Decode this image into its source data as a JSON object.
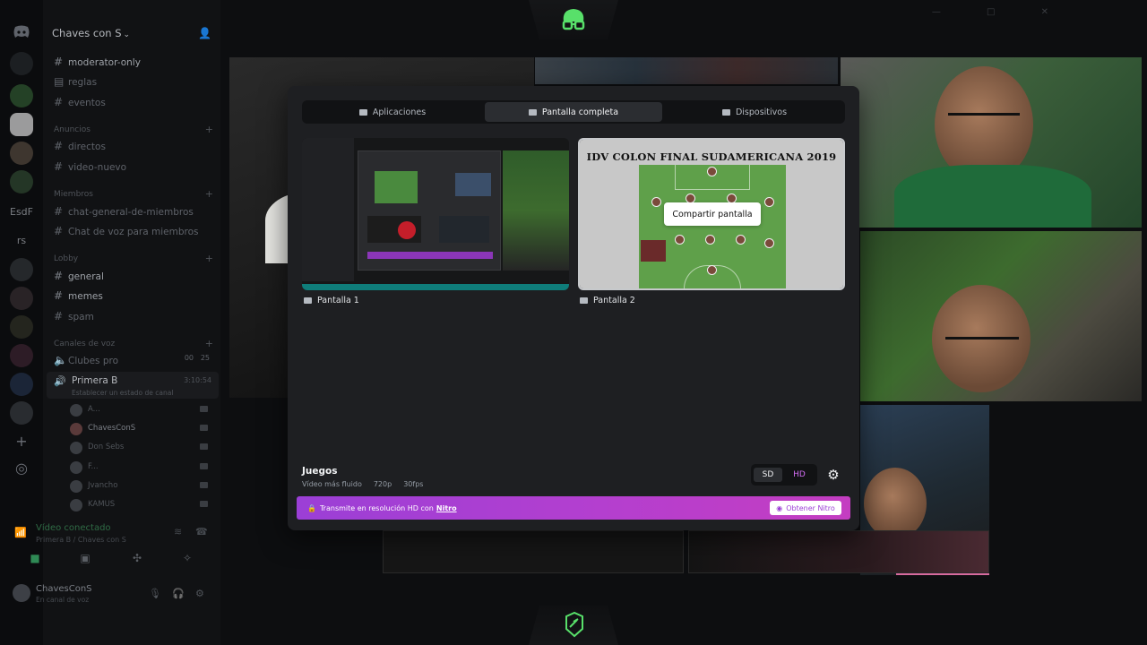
{
  "server": {
    "name": "Chaves con S",
    "rail_labels": [
      "EsdF",
      "rs"
    ]
  },
  "channels": {
    "top": [
      {
        "name": "moderator-only",
        "bright": true
      },
      {
        "name": "reglas",
        "bright": false
      },
      {
        "name": "eventos",
        "bright": false
      }
    ],
    "categories": {
      "anuncios": "Anuncios",
      "miembros": "Miembros",
      "lobby": "Lobby",
      "voz": "Canales de voz"
    },
    "anuncios": [
      "directos",
      "video-nuevo"
    ],
    "miembros": [
      "chat-general-de-miembros",
      "Chat de voz para miembros"
    ],
    "lobby": [
      {
        "name": "general",
        "bright": true
      },
      {
        "name": "memes",
        "bright": true
      },
      {
        "name": "spam",
        "bright": false
      }
    ],
    "voice": {
      "clubes": "Clubes pro",
      "clubes_count": "00",
      "clubes_count2": "25",
      "active_name": "Primera B",
      "active_sub": "Establecer un estado de canal",
      "active_time": "3:10:54",
      "members": [
        "A...",
        "ChavesConS",
        "Don Sebs",
        "F...",
        "Jvancho",
        "KAMUS"
      ]
    }
  },
  "voice_status": {
    "title": "Vídeo conectado",
    "sub": "Primera B / Chaves con S"
  },
  "user": {
    "name": "ChavesConS",
    "status": "En canal de voz"
  },
  "modal": {
    "tabs": [
      {
        "label": "Aplicaciones",
        "active": false
      },
      {
        "label": "Pantalla completa",
        "active": true
      },
      {
        "label": "Dispositivos",
        "active": false
      }
    ],
    "screens": [
      {
        "label": "Pantalla 1",
        "selected": false
      },
      {
        "label": "Pantalla 2",
        "selected": true
      }
    ],
    "preview2_title": "IDV COLON FINAL SUDAMERICANA 2019",
    "share_button": "Compartir pantalla",
    "games_title": "Juegos",
    "games_mode": "Vídeo más fluido",
    "games_res": "720p",
    "games_fps": "30fps",
    "quality_sd": "SD",
    "quality_hd": "HD",
    "nitro_text": "Transmite en resolución HD con",
    "nitro_link": "Nitro",
    "nitro_button": "Obtener Nitro"
  },
  "colors": {
    "accent_nitro": "#b43fcf",
    "brand_green": "#58e06a"
  }
}
